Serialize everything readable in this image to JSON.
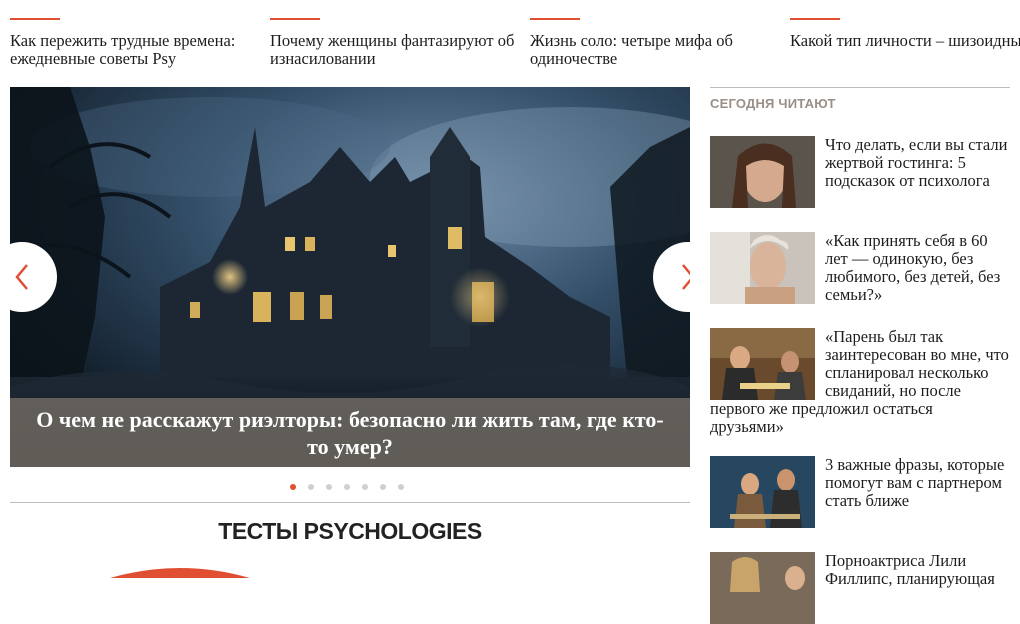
{
  "top_articles": [
    {
      "title": "Как пережить трудные времена: ежедневные советы Psy"
    },
    {
      "title": "Почему женщины фантазируют об изнасиловании"
    },
    {
      "title": "Жизнь соло: четыре мифа об одиночестве"
    },
    {
      "title": "Какой тип личности – шизоидный?"
    }
  ],
  "slider": {
    "caption": "О чем не расскажут риэлторы: безопасно ли жить там, где кто-то умер?",
    "dots_total": 7,
    "active_dot": 1,
    "prev_icon": "chevron-left-icon",
    "next_icon": "chevron-right-icon"
  },
  "tests": {
    "heading": "ТЕСТЫ PSYCHOLOGIES"
  },
  "sidebar": {
    "heading": "СЕГОДНЯ ЧИТАЮТ",
    "articles": [
      {
        "title": "Что делать, если вы стали жертвой гостинга: 5 подсказок от психолога"
      },
      {
        "title": "«Как принять себя в 60 лет — одинокую, без любимого, без детей, без семьи?»"
      },
      {
        "title": "«Парень был так заинтересован во мне, что спланировал несколько свиданий, но после первого же предложил остаться друзьями»"
      },
      {
        "title": "3 важные фразы, которые помогут вам с партнером стать ближе"
      },
      {
        "title": "Порноактриса Лили Филлипс, планирующая"
      }
    ]
  },
  "colors": {
    "accent": "#e14f33",
    "caption_bg": "#6c6660",
    "sidebar_head": "#9a8f87"
  }
}
